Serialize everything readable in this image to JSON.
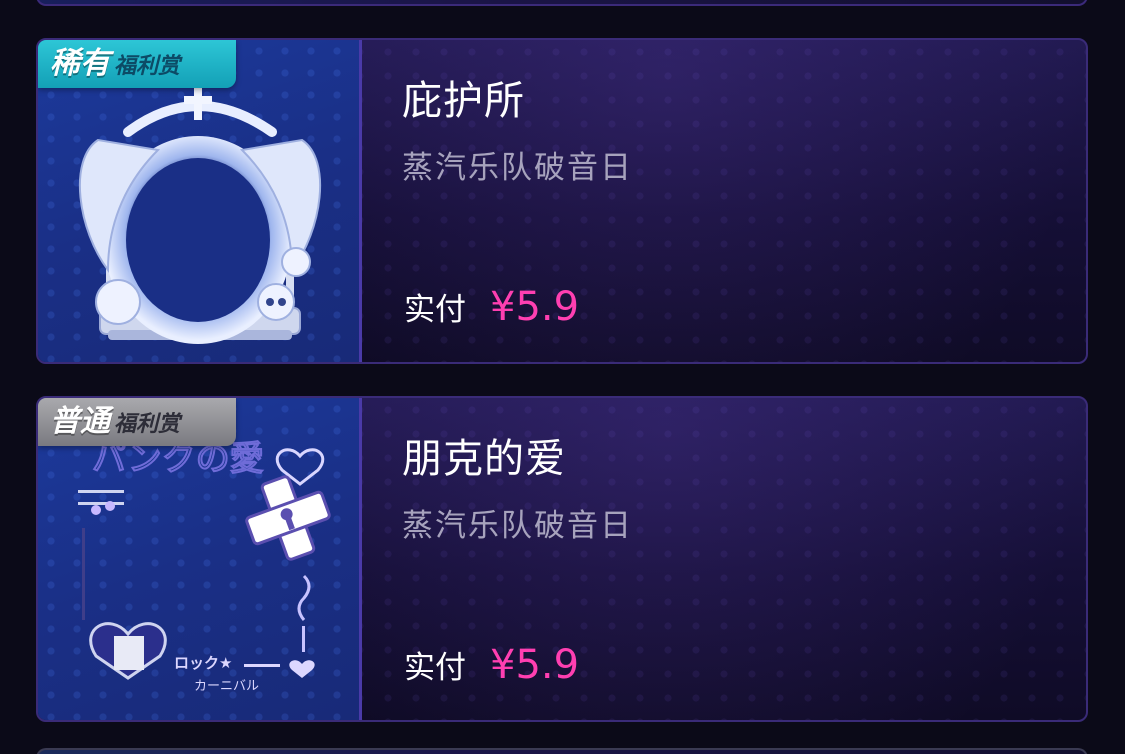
{
  "items": [
    {
      "tier": "稀有",
      "kind": "福利赏",
      "title": "庇护所",
      "subtitle": "蒸汽乐队破音日",
      "price_label": "实付",
      "price": "¥5.9",
      "thumbnail_icon": "winged-arch-frame-icon"
    },
    {
      "tier": "普通",
      "kind": "福利赏",
      "title": "朋克的爱",
      "subtitle": "蒸汽乐队破音日",
      "price_label": "实付",
      "price": "¥5.9",
      "thumbnail_icon": "punk-love-frame-icon",
      "thumbnail_text_top": "パンクの愛",
      "thumbnail_text_bottom_1": "ロック★",
      "thumbnail_text_bottom_2": "カーニバル"
    }
  ],
  "colors": {
    "background": "#0b0a18",
    "price": "#ff3fb1",
    "rare_badge": "#1fb3c6",
    "common_badge": "#8d8d93",
    "card_border": "#3a2b78"
  }
}
